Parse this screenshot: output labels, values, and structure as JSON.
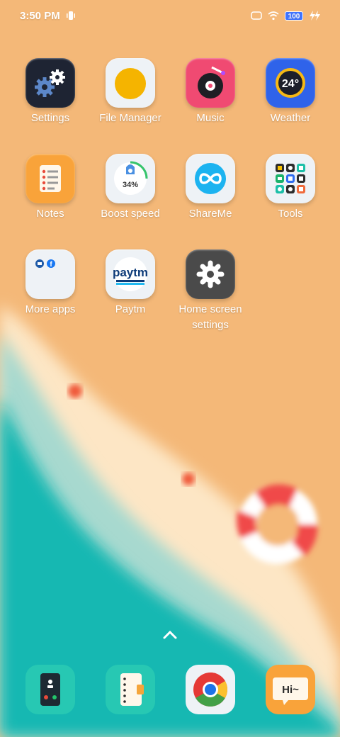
{
  "status": {
    "time": "3:50 PM",
    "battery": "100"
  },
  "apps": [
    {
      "label": "Settings"
    },
    {
      "label": "File Manager"
    },
    {
      "label": "Music"
    },
    {
      "label": "Weather",
      "temp": "24°"
    },
    {
      "label": "Notes"
    },
    {
      "label": "Boost speed",
      "percent": "34%"
    },
    {
      "label": "ShareMe"
    },
    {
      "label": "Tools"
    },
    {
      "label": "More apps"
    },
    {
      "label": "Paytm",
      "logo_text": "paytm"
    },
    {
      "label": "Home screen settings"
    }
  ],
  "dock": [
    {
      "name": "Phone"
    },
    {
      "name": "Contacts"
    },
    {
      "name": "Chrome"
    },
    {
      "name": "Messaging",
      "text": "Hi~"
    }
  ],
  "colors": {
    "sand": "#f4b878",
    "sea": "#17b8b2",
    "foam": "#fde6c5"
  }
}
